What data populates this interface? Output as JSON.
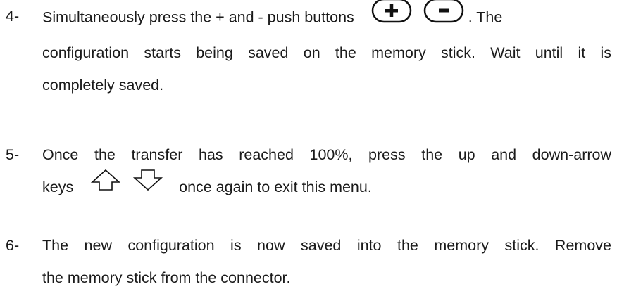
{
  "steps": [
    {
      "number": "4-",
      "line1_before": "Simultaneously press the + and - push buttons",
      "line1_after": ". The",
      "line2": "configuration starts being saved on the memory stick. Wait until it is",
      "line3": "completely saved.",
      "icons": [
        "plus-button-icon",
        "minus-button-icon"
      ]
    },
    {
      "number": "5-",
      "line1": "Once the transfer has reached 100%, press the up and down-arrow",
      "line2_before": "keys",
      "line2_after": "once again to exit this menu.",
      "icons": [
        "up-arrow-key-icon",
        "down-arrow-key-icon"
      ]
    },
    {
      "number": "6-",
      "line1": "The new configuration is now saved into the memory stick. Remove",
      "line2": "the memory stick from the connector."
    }
  ]
}
